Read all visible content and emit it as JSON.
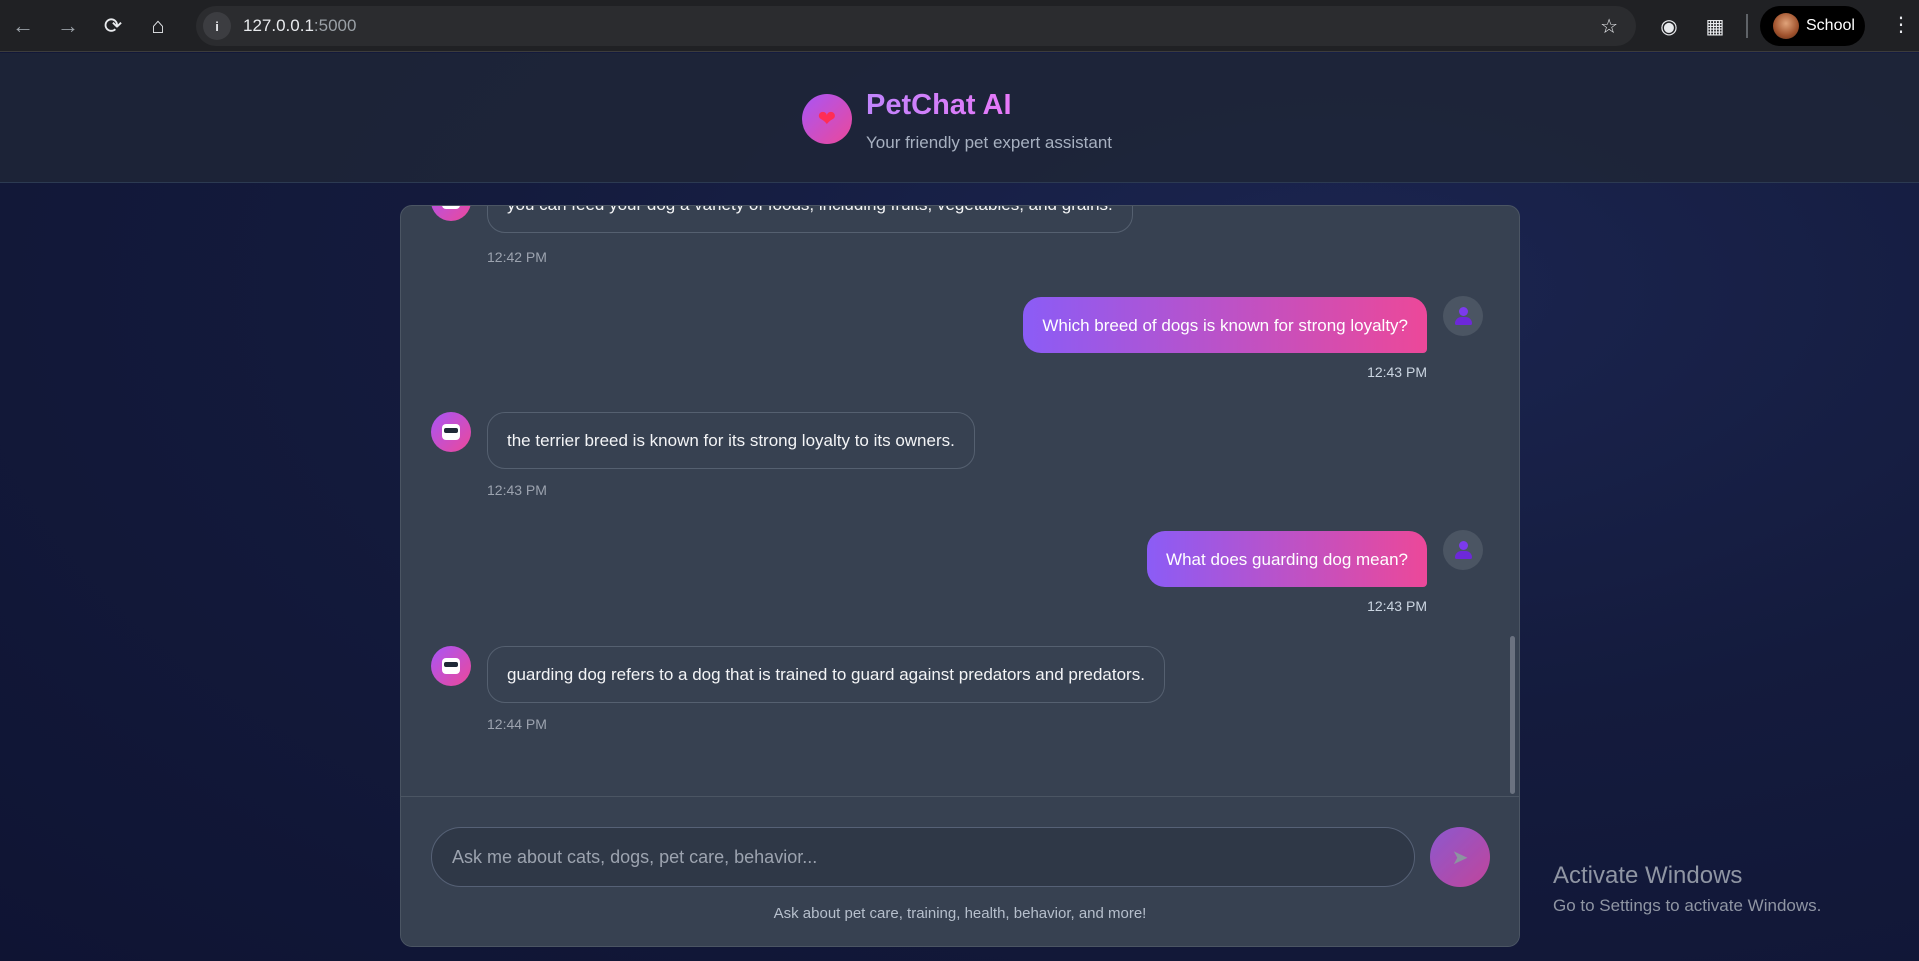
{
  "browser": {
    "url_host": "127.0.0.1",
    "url_port": ":5000",
    "profile_name": "School"
  },
  "app": {
    "title": "PetChat AI",
    "subtitle": "Your friendly pet expert assistant",
    "logo_icon": "heart-icon"
  },
  "messages": [
    {
      "role": "bot",
      "text": "you can feed your dog a variety of foods, including fruits, vegetables, and grains.",
      "time": "12:42 PM"
    },
    {
      "role": "user",
      "text": "Which breed of dogs is known for strong loyalty?",
      "time": "12:43 PM"
    },
    {
      "role": "bot",
      "text": "the terrier breed is known for its strong loyalty to its owners.",
      "time": "12:43 PM"
    },
    {
      "role": "user",
      "text": "What does guarding dog mean?",
      "time": "12:43 PM"
    },
    {
      "role": "bot",
      "text": "guarding dog refers to a dog that is trained to guard against predators and predators.",
      "time": "12:44 PM"
    }
  ],
  "input": {
    "placeholder": "Ask me about cats, dogs, pet care, behavior...",
    "value": "",
    "hint": "Ask about pet care, training, health, behavior, and more!",
    "send_icon": "send-icon"
  },
  "watermark": {
    "title": "Activate Windows",
    "subtitle": "Go to Settings to activate Windows."
  },
  "colors": {
    "accent_start": "#8b5cf6",
    "accent_end": "#ec4899",
    "panel_bg": "#374151"
  }
}
